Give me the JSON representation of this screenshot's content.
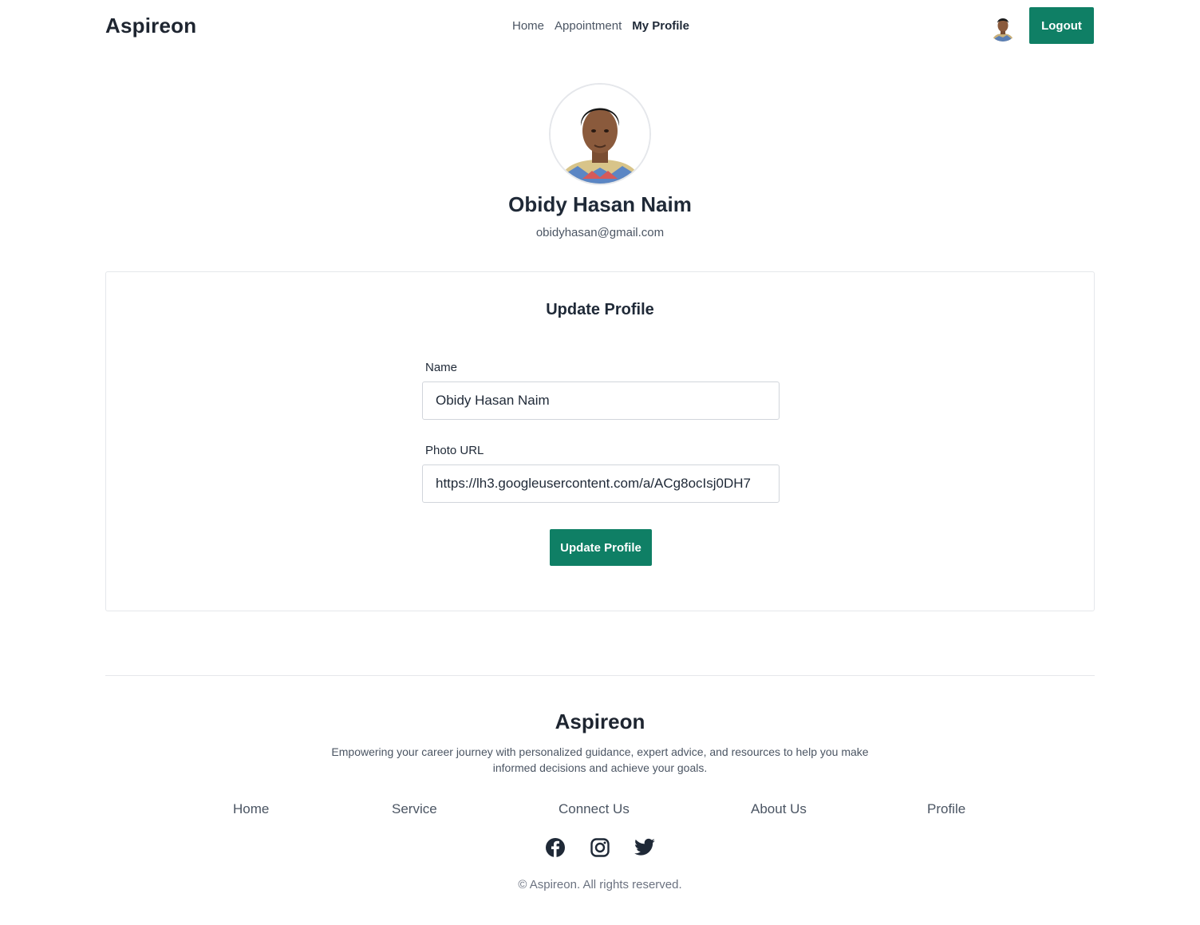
{
  "header": {
    "brand": "Aspireon",
    "nav": [
      "Home",
      "Appointment",
      "My Profile"
    ],
    "active_nav": "My Profile",
    "logout_label": "Logout"
  },
  "profile": {
    "name": "Obidy Hasan Naim",
    "email": "obidyhasan@gmail.com"
  },
  "form": {
    "title": "Update Profile",
    "name_label": "Name",
    "name_value": "Obidy Hasan Naim",
    "photo_label": "Photo URL",
    "photo_value": "https://lh3.googleusercontent.com/a/ACg8ocIsj0DH7",
    "submit_label": "Update Profile"
  },
  "footer": {
    "brand": "Aspireon",
    "description": "Empowering your career journey with personalized guidance, expert advice, and resources to help you make informed decisions and achieve your goals.",
    "links": [
      "Home",
      "Service",
      "Connect Us",
      "About Us",
      "Profile"
    ],
    "social_icons": [
      "facebook-icon",
      "instagram-icon",
      "twitter-icon"
    ],
    "copyright": "© Aspireon. All rights reserved."
  },
  "colors": {
    "accent": "#0f7f65",
    "text": "#1f2937",
    "muted": "#4b5563"
  }
}
